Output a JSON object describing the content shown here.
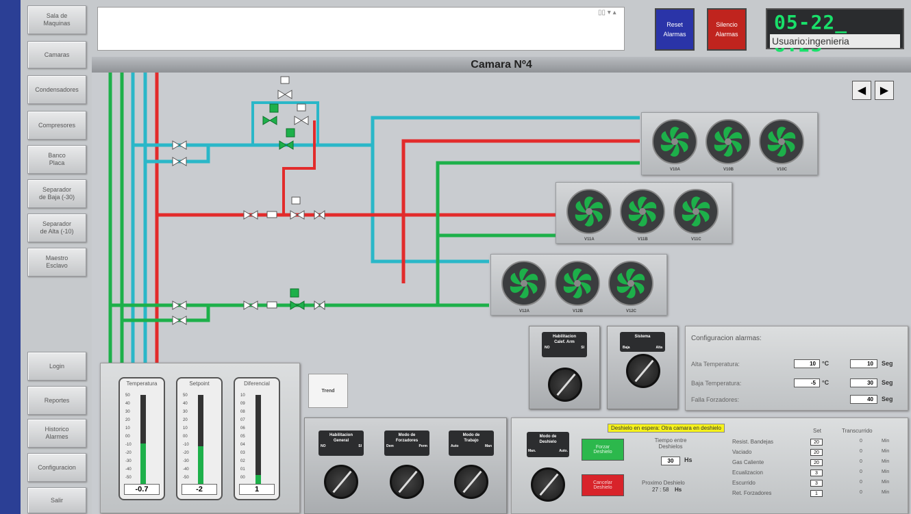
{
  "sidebar": {
    "items": [
      {
        "label": "Sala de\nMaquinas"
      },
      {
        "label": "Camaras"
      },
      {
        "label": "Condensadores"
      },
      {
        "label": "Compresores"
      },
      {
        "label": "Banco\nPlaca"
      },
      {
        "label": "Separador\nde Baja (-30)"
      },
      {
        "label": "Separador\nde Alta (-10)"
      },
      {
        "label": "Maestro\nEsclavo"
      },
      {
        "label": "Login"
      },
      {
        "label": "Reportes"
      },
      {
        "label": "Historico\nAlarmes"
      },
      {
        "label": "Configuracion"
      },
      {
        "label": "Salir"
      }
    ]
  },
  "header": {
    "reset_label": "Reset\nAlarmas",
    "silence_label": "Silencio\nAlarmas",
    "clock": "05-22_ 8:23",
    "user": "Usuario:ingenieria",
    "title": "Camara Nº4",
    "colors": {
      "reset": "#2a34a8",
      "silence": "#c0241e",
      "clock_digits": "#19e06a"
    }
  },
  "fans": {
    "row1": [
      "V10A",
      "V10B",
      "V10C"
    ],
    "row2": [
      "V11A",
      "V11B",
      "V11C"
    ],
    "row3": [
      "V12A",
      "V12B",
      "V12C"
    ]
  },
  "gauges": [
    {
      "title": "Temperatura",
      "value": "-0.7",
      "level": 0.45,
      "ticks": [
        "50",
        "40",
        "30",
        "20",
        "10",
        "00",
        "-10",
        "-20",
        "-30",
        "-40",
        "-50"
      ]
    },
    {
      "title": "Setpoint",
      "value": "-2",
      "level": 0.42,
      "ticks": [
        "50",
        "40",
        "30",
        "20",
        "10",
        "00",
        "-10",
        "-20",
        "-30",
        "-40",
        "-50"
      ]
    },
    {
      "title": "Diferencial",
      "value": "1",
      "level": 0.1,
      "ticks": [
        "10",
        "09",
        "08",
        "07",
        "06",
        "05",
        "04",
        "03",
        "02",
        "01",
        "00"
      ]
    }
  ],
  "trend_label": "Trend",
  "knobs": {
    "calef": {
      "title": "Habilitacion\nCalef. Arm",
      "left": "NO",
      "right": "SI"
    },
    "sistema": {
      "title": "Sistema",
      "left": "Baja",
      "right": "Alta"
    },
    "general": {
      "title": "Habilitacion\nGeneral",
      "left": "NO",
      "right": "SI"
    },
    "forzadores": {
      "title": "Modo de\nForzadores",
      "left": "Dem",
      "right": "Perm"
    },
    "trabajo": {
      "title": "Modo de\nTrabajo",
      "left": "Auto",
      "right": "Man"
    },
    "deshielo": {
      "title": "Modo de\nDeshielo",
      "left": "Man.",
      "right": "Auto."
    }
  },
  "alarm_config": {
    "title": "Configuracion alarmas:",
    "rows": [
      {
        "label": "Alta Temperatura:",
        "temp": "10",
        "unit": "°C",
        "secs": "10",
        "secs_unit": "Seg"
      },
      {
        "label": "Baja Temperatura:",
        "temp": "-5",
        "unit": "°C",
        "secs": "30",
        "secs_unit": "Seg"
      },
      {
        "label": "Falla Forzadores:",
        "temp": "",
        "unit": "",
        "secs": "40",
        "secs_unit": "Seg"
      }
    ]
  },
  "defrost": {
    "status": "Deshielo en espera: Otra camara en deshielo",
    "force_label": "Forzar\nDeshielo",
    "cancel_label": "Cancelar\nDeshielo",
    "interval_label": "Tiempo entre\nDeshielos",
    "interval_value": "30",
    "interval_unit": "Hs",
    "next_label": "Proximo Deshielo",
    "next_value": "27 : 58",
    "next_unit": "Hs",
    "col_set": "Set",
    "col_elapsed": "Transcurrido",
    "rows": [
      {
        "label": "Resist. Bandejas",
        "set": "20",
        "elapsed": "0",
        "unit": "Min"
      },
      {
        "label": "Vaciado",
        "set": "20",
        "elapsed": "0",
        "unit": "Min"
      },
      {
        "label": "Gas Caliente",
        "set": "20",
        "elapsed": "0",
        "unit": "Min"
      },
      {
        "label": "Ecualizacion",
        "set": "3",
        "elapsed": "0",
        "unit": "Min"
      },
      {
        "label": "Escurrido",
        "set": "3",
        "elapsed": "0",
        "unit": "Min"
      },
      {
        "label": "Ret. Forzadores",
        "set": "1",
        "elapsed": "0",
        "unit": "Min"
      }
    ]
  }
}
